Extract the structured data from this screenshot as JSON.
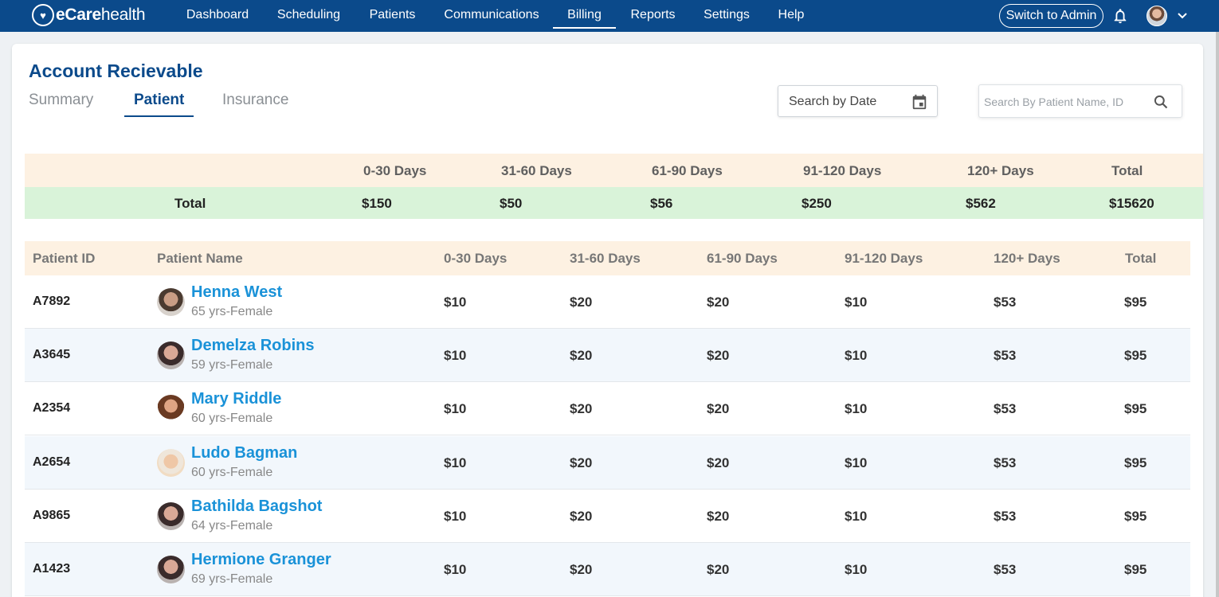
{
  "app": {
    "logo_bold": "eCare",
    "logo_light": "health",
    "nav": [
      {
        "label": "Dashboard"
      },
      {
        "label": "Scheduling"
      },
      {
        "label": "Patients"
      },
      {
        "label": "Communications"
      },
      {
        "label": "Billing",
        "active": true
      },
      {
        "label": "Reports"
      },
      {
        "label": "Settings"
      },
      {
        "label": "Help"
      }
    ],
    "switch_admin": "Switch to Admin"
  },
  "page": {
    "title": "Account Recievable",
    "tabs": [
      {
        "label": "Summary"
      },
      {
        "label": "Patient",
        "active": true
      },
      {
        "label": "Insurance"
      }
    ],
    "date_search_placeholder": "Search by Date",
    "patient_search_placeholder": "Search By Patient Name, ID"
  },
  "summary": {
    "headers": [
      "0-30 Days",
      "31-60 Days",
      "61-90 Days",
      "91-120 Days",
      "120+ Days",
      "Total"
    ],
    "total_label": "Total",
    "totals": [
      "$150",
      "$50",
      "$56",
      "$250",
      "$562",
      "$15620"
    ]
  },
  "patients": {
    "headers": [
      "Patient ID",
      "Patient Name",
      "0-30 Days",
      "31-60 Days",
      "61-90 Days",
      "91-120 Days",
      "120+ Days",
      "Total"
    ],
    "rows": [
      {
        "id": "A7892",
        "name": "Henna West",
        "meta": "65 yrs-Female",
        "amounts": [
          "$10",
          "$20",
          "$20",
          "$10",
          "$53",
          "$95"
        ]
      },
      {
        "id": "A3645",
        "name": "Demelza Robins",
        "meta": "59 yrs-Female",
        "amounts": [
          "$10",
          "$20",
          "$20",
          "$10",
          "$53",
          "$95"
        ]
      },
      {
        "id": "A2354",
        "name": "Mary Riddle",
        "meta": "60 yrs-Female",
        "amounts": [
          "$10",
          "$20",
          "$20",
          "$10",
          "$53",
          "$95"
        ]
      },
      {
        "id": "A2654",
        "name": "Ludo Bagman",
        "meta": "60 yrs-Female",
        "amounts": [
          "$10",
          "$20",
          "$20",
          "$10",
          "$53",
          "$95"
        ]
      },
      {
        "id": "A9865",
        "name": "Bathilda Bagshot",
        "meta": "64 yrs-Female",
        "amounts": [
          "$10",
          "$20",
          "$20",
          "$10",
          "$53",
          "$95"
        ]
      },
      {
        "id": "A1423",
        "name": "Hermione Granger",
        "meta": "69 yrs-Female",
        "amounts": [
          "$10",
          "$20",
          "$20",
          "$10",
          "$53",
          "$95"
        ]
      }
    ]
  },
  "colors": {
    "brand": "#0b4a8b",
    "link": "#1a92d8",
    "header_bg": "#fdf1e2",
    "total_bg": "#d9f3d9",
    "alt_row_bg": "#f2f7fc"
  },
  "icons": [
    "logo-heart-icon",
    "bell-icon",
    "chevron-down-icon",
    "calendar-icon",
    "search-icon"
  ]
}
